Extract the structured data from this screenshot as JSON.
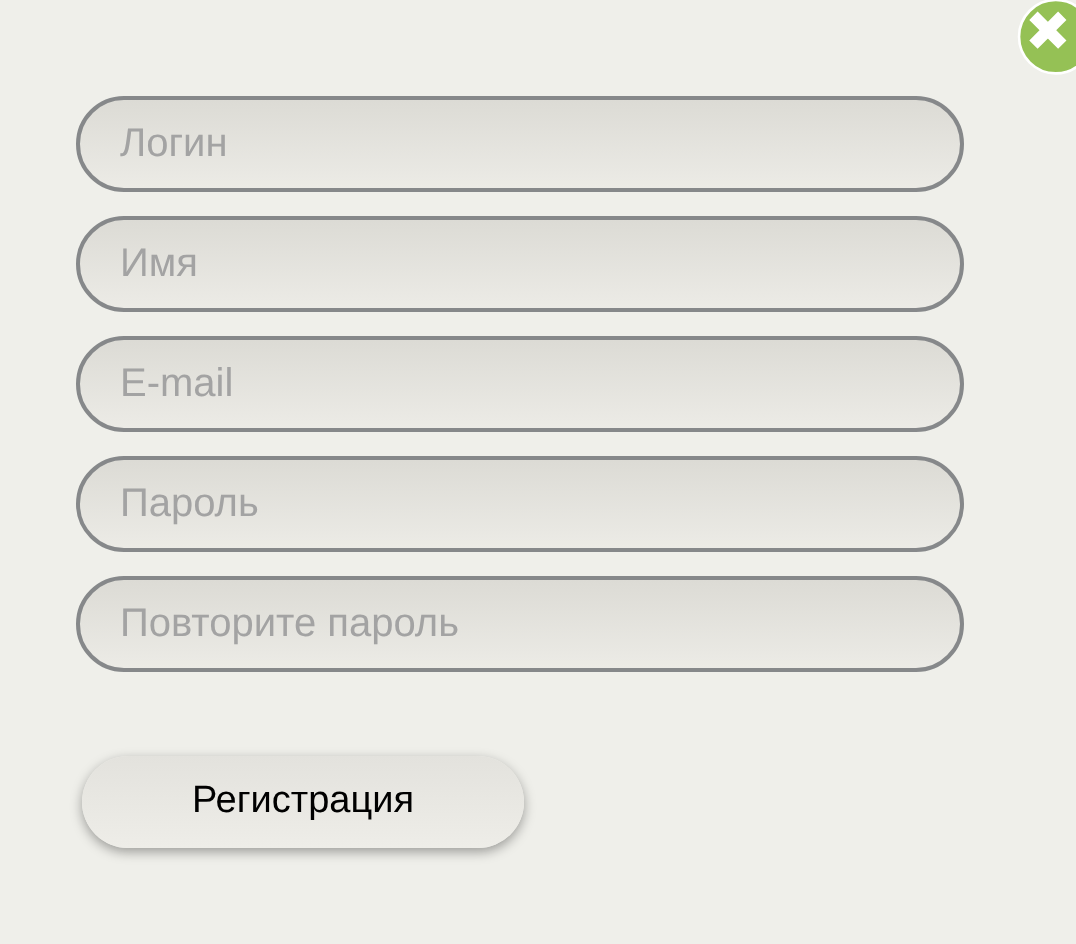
{
  "fields": [
    {
      "placeholder": "Логин"
    },
    {
      "placeholder": "Имя"
    },
    {
      "placeholder": "E-mail"
    },
    {
      "placeholder": "Пароль"
    },
    {
      "placeholder": "Повторите пароль"
    }
  ],
  "submit": {
    "label": "Регистрация"
  }
}
